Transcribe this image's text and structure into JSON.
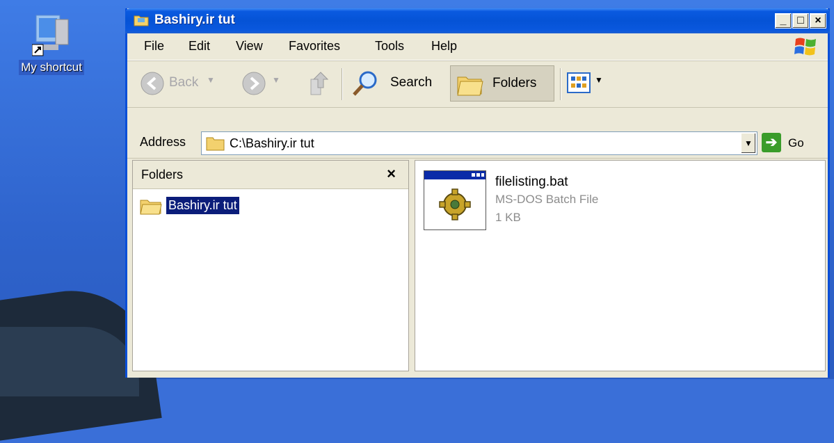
{
  "desktop": {
    "shortcut_label": "My shortcut"
  },
  "window": {
    "title": "Bashiry.ir tut",
    "controls": {
      "minimize": "_",
      "maximize": "□",
      "close": "×"
    }
  },
  "menubar": {
    "items": [
      "File",
      "Edit",
      "View",
      "Favorites",
      "Tools",
      "Help"
    ]
  },
  "toolbar": {
    "back_label": "Back",
    "search_label": "Search",
    "folders_label": "Folders"
  },
  "address": {
    "label": "Address",
    "value": "C:\\Bashiry.ir tut",
    "go_label": "Go"
  },
  "folders_pane": {
    "title": "Folders",
    "close": "×",
    "tree": [
      {
        "label": "Bashiry.ir tut",
        "selected": true
      }
    ]
  },
  "files": [
    {
      "name": "filelisting.bat",
      "type": "MS-DOS Batch File",
      "size": "1 KB",
      "icon": "batch-file-gear-icon"
    }
  ],
  "colors": {
    "titlebar": "#0553d6",
    "selection": "#0b1d7a",
    "window_bg": "#ece9d8"
  }
}
